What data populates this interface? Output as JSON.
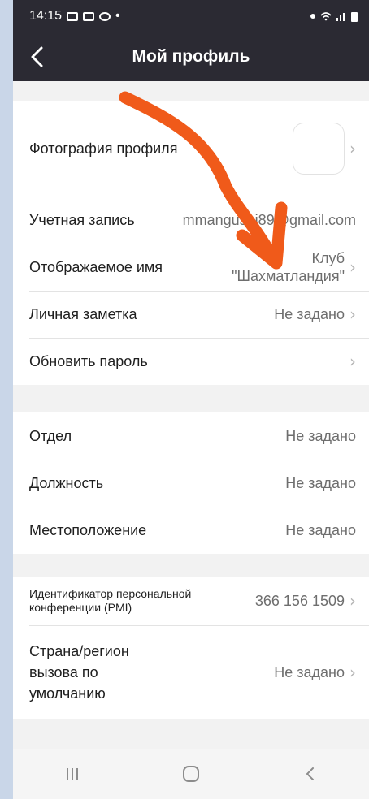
{
  "status": {
    "time": "14:15",
    "dot": "•"
  },
  "header": {
    "title": "Мой профиль"
  },
  "profile": {
    "photo_label": "Фотография профиля",
    "account_label": "Учетная запись",
    "account_value": "mmangushi89@gmail.com",
    "display_name_label": "Отображаемое имя",
    "display_name_line1": "Клуб",
    "display_name_line2": "\"Шахматландия\"",
    "note_label": "Личная заметка",
    "note_value": "Не задано",
    "password_label": "Обновить пароль"
  },
  "work": {
    "department_label": "Отдел",
    "department_value": "Не задано",
    "position_label": "Должность",
    "position_value": "Не задано",
    "location_label": "Местоположение",
    "location_value": "Не задано"
  },
  "meeting": {
    "pmi_label_line1": "Идентификатор персональной",
    "pmi_label_line2": "конференции (PMI)",
    "pmi_value": "366 156 1509",
    "country_label_line1": "Страна/регион",
    "country_label_line2": "вызова по",
    "country_label_line3": "умолчанию",
    "country_value": "Не задано"
  },
  "chevron": "›",
  "colors": {
    "appbar": "#2b2a33",
    "annotation_arrow": "#f05a1a",
    "background": "#f2f2f2"
  },
  "icons": [
    "back-arrow-icon",
    "recents-icon",
    "home-icon",
    "nav-back-icon",
    "gallery-icon",
    "cast-icon",
    "whatsapp-icon",
    "alarm-icon",
    "wifi-icon",
    "signal-icon",
    "battery-icon"
  ]
}
